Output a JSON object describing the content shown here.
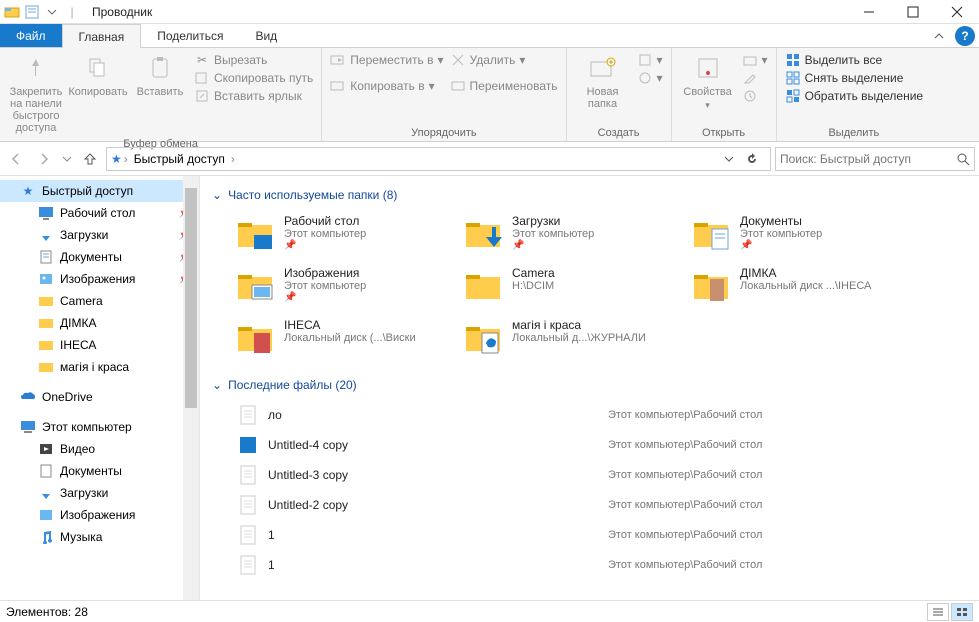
{
  "title": "Проводник",
  "tabs": {
    "file": "Файл",
    "home": "Главная",
    "share": "Поделиться",
    "view": "Вид"
  },
  "ribbon": {
    "pin": "Закрепить на панели\nбыстрого доступа",
    "copy": "Копировать",
    "paste": "Вставить",
    "cut": "Вырезать",
    "copypath": "Скопировать путь",
    "pastelnk": "Вставить ярлык",
    "g_clipboard": "Буфер обмена",
    "moveto": "Переместить в",
    "copyto": "Копировать в",
    "delete": "Удалить",
    "rename": "Переименовать",
    "g_organize": "Упорядочить",
    "newfolder": "Новая\nпапка",
    "g_create": "Создать",
    "properties": "Свойства",
    "g_open": "Открыть",
    "selectall": "Выделить все",
    "selectnone": "Снять выделение",
    "invert": "Обратить выделение",
    "g_select": "Выделить"
  },
  "breadcrumb": {
    "root": "Быстрый доступ"
  },
  "search_placeholder": "Поиск: Быстрый доступ",
  "nav": {
    "quick": "Быстрый доступ",
    "desktop": "Рабочий стол",
    "downloads": "Загрузки",
    "documents": "Документы",
    "pictures": "Изображения",
    "camera": "Camera",
    "dimka": "ДІМКА",
    "inesa": "ІНЕСА",
    "magia": "магія і краса",
    "onedrive": "OneDrive",
    "thispc": "Этот компьютер",
    "videos": "Видео",
    "documents2": "Документы",
    "downloads2": "Загрузки",
    "pictures2": "Изображения",
    "music": "Музыка"
  },
  "sections": {
    "frequent": "Часто используемые папки (8)",
    "recent": "Последние файлы (20)"
  },
  "folders": [
    {
      "name": "Рабочий стол",
      "path": "Этот компьютер",
      "pinned": true,
      "icon": "desktop"
    },
    {
      "name": "Загрузки",
      "path": "Этот компьютер",
      "pinned": true,
      "icon": "downloads"
    },
    {
      "name": "Документы",
      "path": "Этот компьютер",
      "pinned": true,
      "icon": "documents"
    },
    {
      "name": "Изображения",
      "path": "Этот компьютер",
      "pinned": true,
      "icon": "pictures"
    },
    {
      "name": "Camera",
      "path": "H:\\DCIM",
      "pinned": false,
      "icon": "folder"
    },
    {
      "name": "ДІМКА",
      "path": "Локальный диск ...\\ІНЕСА",
      "pinned": false,
      "icon": "thumb"
    },
    {
      "name": "ІНЕСА",
      "path": "Локальный диск (...\\Виски",
      "pinned": false,
      "icon": "thumb2"
    },
    {
      "name": "магія і краса",
      "path": "Локальный д...\\ЖУРНАЛИ",
      "pinned": false,
      "icon": "edge"
    }
  ],
  "files": [
    {
      "name": "ло",
      "path": "Этот компьютер\\Рабочий стол",
      "icon": "doc"
    },
    {
      "name": "Untitled-4 copy",
      "path": "Этот компьютер\\Рабочий стол",
      "icon": "blue"
    },
    {
      "name": "Untitled-3 copy",
      "path": "Этот компьютер\\Рабочий стол",
      "icon": "doc"
    },
    {
      "name": "Untitled-2 copy",
      "path": "Этот компьютер\\Рабочий стол",
      "icon": "doc"
    },
    {
      "name": "1",
      "path": "Этот компьютер\\Рабочий стол",
      "icon": "doc"
    },
    {
      "name": "1",
      "path": "Этот компьютер\\Рабочий стол",
      "icon": "doc"
    }
  ],
  "status": "Элементов: 28"
}
